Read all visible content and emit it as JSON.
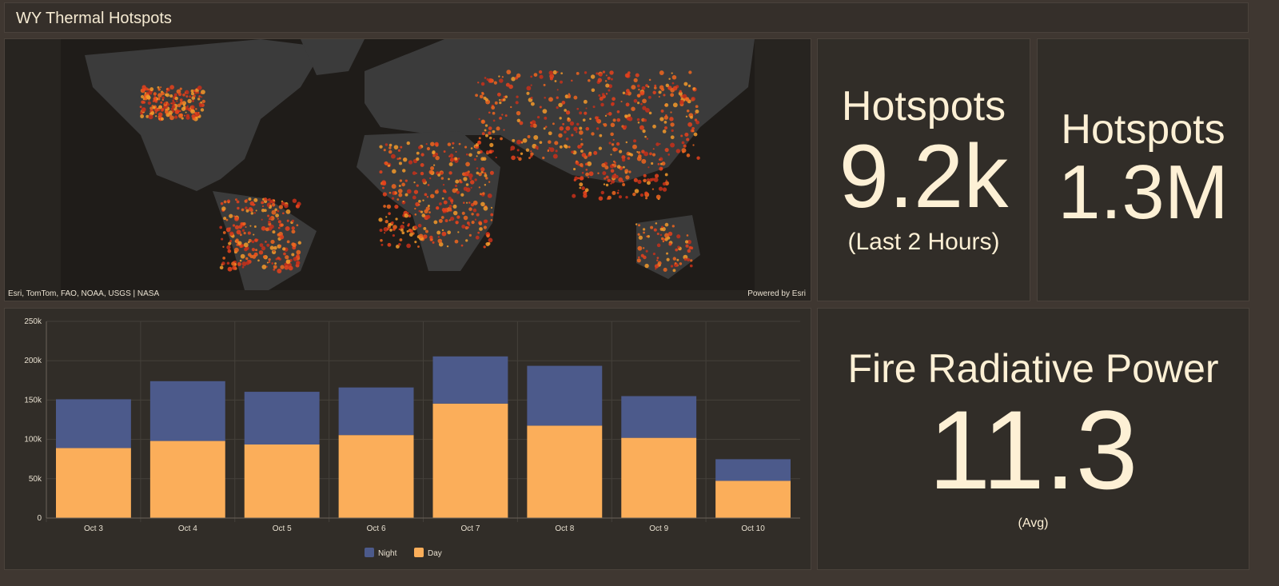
{
  "header": {
    "title": "WY Thermal Hotspots"
  },
  "map": {
    "attribution": "Esri, TomTom, FAO, NOAA, USGS | NASA",
    "powered_by": "Powered by Esri"
  },
  "kpi_recent": {
    "title": "Hotspots",
    "value": "9.2k",
    "subtitle": "(Last 2 Hours)"
  },
  "kpi_total": {
    "title": "Hotspots",
    "value": "1.3M"
  },
  "kpi_frp": {
    "title": "Fire Radiative Power",
    "value": "11.3",
    "subtitle": "(Avg)"
  },
  "colors": {
    "night": "#4c5a8b",
    "day": "#fbae5a",
    "hotspot": "#e8421c"
  },
  "chart_data": {
    "type": "bar",
    "stacked": true,
    "categories": [
      "Oct 3",
      "Oct 4",
      "Oct 5",
      "Oct 6",
      "Oct 7",
      "Oct 8",
      "Oct 9",
      "Oct 10"
    ],
    "series": [
      {
        "name": "Night",
        "values": [
          62000,
          76000,
          67000,
          60500,
          60000,
          76000,
          53000,
          27500
        ]
      },
      {
        "name": "Day",
        "values": [
          89000,
          98000,
          93500,
          105500,
          145500,
          117500,
          102000,
          47300
        ]
      }
    ],
    "yticks": [
      "0",
      "50k",
      "100k",
      "150k",
      "200k",
      "250k"
    ],
    "ylim": [
      0,
      250000
    ],
    "legend": [
      "Night",
      "Day"
    ],
    "legend_position": "bottom"
  }
}
